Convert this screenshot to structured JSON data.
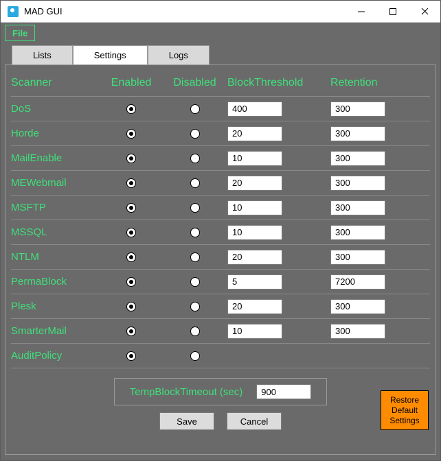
{
  "window": {
    "title": "MAD GUI"
  },
  "menu": {
    "file": "File"
  },
  "tabs": {
    "lists": "Lists",
    "settings": "Settings",
    "logs": "Logs"
  },
  "headers": {
    "scanner": "Scanner",
    "enabled": "Enabled",
    "disabled": "Disabled",
    "blockthreshold": "BlockThreshold",
    "retention": "Retention"
  },
  "rows": [
    {
      "name": "DoS",
      "enabled": true,
      "blockthreshold": "400",
      "retention": "300"
    },
    {
      "name": "Horde",
      "enabled": true,
      "blockthreshold": "20",
      "retention": "300"
    },
    {
      "name": "MailEnable",
      "enabled": true,
      "blockthreshold": "10",
      "retention": "300"
    },
    {
      "name": "MEWebmail",
      "enabled": true,
      "blockthreshold": "20",
      "retention": "300"
    },
    {
      "name": "MSFTP",
      "enabled": true,
      "blockthreshold": "10",
      "retention": "300"
    },
    {
      "name": "MSSQL",
      "enabled": true,
      "blockthreshold": "10",
      "retention": "300"
    },
    {
      "name": "NTLM",
      "enabled": true,
      "blockthreshold": "20",
      "retention": "300"
    },
    {
      "name": "PermaBlock",
      "enabled": true,
      "blockthreshold": "5",
      "retention": "7200"
    },
    {
      "name": "Plesk",
      "enabled": true,
      "blockthreshold": "20",
      "retention": "300"
    },
    {
      "name": "SmarterMail",
      "enabled": true,
      "blockthreshold": "10",
      "retention": "300"
    },
    {
      "name": "AuditPolicy",
      "enabled": true,
      "blockthreshold": "",
      "retention": ""
    }
  ],
  "timeout": {
    "label": "TempBlockTimeout (sec)",
    "value": "900"
  },
  "buttons": {
    "save": "Save",
    "cancel": "Cancel",
    "restore": "Restore\nDefault\nSettings"
  }
}
